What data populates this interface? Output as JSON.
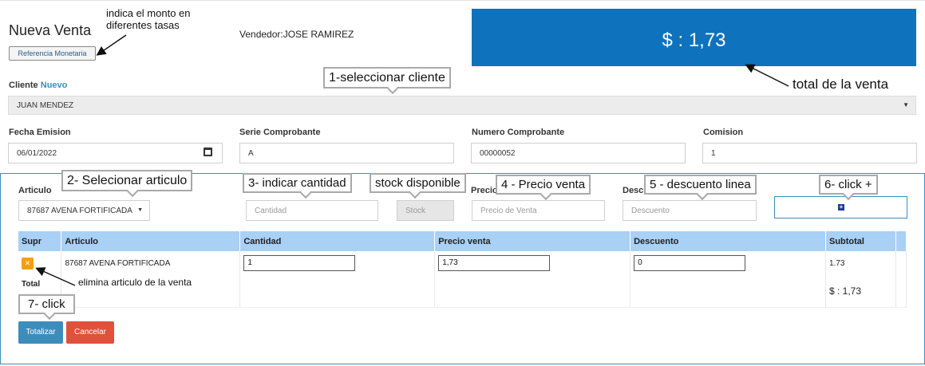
{
  "header": {
    "title": "Nueva Venta",
    "ref_button": "Referencia Monetaria",
    "seller": "Vendedor:JOSE RAMIREZ",
    "total_display": "$ : 1,73"
  },
  "colors": {
    "primary": "#0f72bd",
    "header_blue": "#a9d0f5",
    "warning": "#f0a010",
    "danger": "#e0503a",
    "info": "#3c8dbc"
  },
  "cliente": {
    "label": "Cliente",
    "new_link": "Nuevo",
    "value": "JUAN MENDEZ"
  },
  "fields": {
    "fecha_label": "Fecha Emision",
    "fecha_value": "06/01/2022",
    "serie_label": "Serie Comprobante",
    "serie_value": "A",
    "numero_label": "Numero Comprobante",
    "numero_value": "00000052",
    "comision_label": "Comision",
    "comision_value": "1"
  },
  "detail": {
    "articulo_label": "Articulo",
    "articulo_value": "87687 AVENA FORTIFICADA",
    "stock_label": "Stock",
    "precio_label": "Precio",
    "descuento_label": "Descu",
    "cantidad_placeholder": "Cantidad",
    "stock_placeholder": "Stock",
    "precio_placeholder": "Precio de Venta",
    "descuento_placeholder": "Descuento"
  },
  "table": {
    "headers": [
      "Supr",
      "Articulo",
      "Cantidad",
      "Precio venta",
      "Descuento",
      "Subtotal"
    ],
    "row": {
      "articulo": "87687 AVENA FORTIFICADA",
      "cantidad": "1",
      "precio": "1,73",
      "descuento": "0",
      "subtotal": "1.73"
    },
    "total_label": "Total",
    "total_value": "$ : 1,73"
  },
  "buttons": {
    "totalizar": "Totalizar",
    "cancelar": "Cancelar"
  },
  "annotations": {
    "a1": "1-seleccionar cliente",
    "a2": "2- Selecionar articulo",
    "a3": "3- indicar cantidad",
    "a_stock": "stock disponible",
    "a4": "4 - Precio venta",
    "a5": "5 - descuento linea",
    "a6": "6- click +",
    "a7": "7- click",
    "note_monto_1": "indica el monto en",
    "note_monto_2": "diferentes tasas",
    "note_total": "total de la venta",
    "note_elimina": "elimina articulo de la venta"
  }
}
